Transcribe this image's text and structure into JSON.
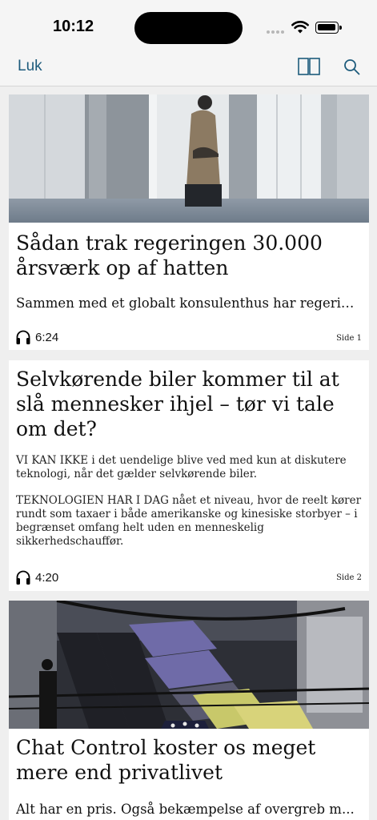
{
  "status_bar": {
    "time": "10:12",
    "icons": [
      "signal-icon",
      "wifi-icon",
      "battery-icon"
    ]
  },
  "nav": {
    "close_label": "Luk",
    "icons": [
      "pages-icon",
      "search-icon"
    ],
    "accent_color": "#1d5b7c"
  },
  "articles": [
    {
      "image": "office-window-photo",
      "headline": "Sådan trak regeringen 30.000 årsværk op af hatten",
      "teaser": "Sammen med et globalt konsulenthus har regeringen...",
      "audio_duration": "6:24",
      "page": "Side 1"
    },
    {
      "headline": "Selvkørende biler kommer til at slå mennesker ihjel – tør vi tale om det?",
      "body_p1": "VI KAN IKKE i det uendelige blive ved med kun at diskutere teknologi, når det gælder selvkørende biler.",
      "body_p2": "TEKNOLOGIEN HAR I DAG nået et niveau, hvor de reelt kører rundt som taxaer i både amerikanske og kinesiske storbyer – i begrænset omfang helt uden en menneskelig sikkerhedschauffør.",
      "audio_duration": "4:20",
      "page": "Side 2"
    },
    {
      "image": "staircase-photo",
      "headline": "Chat Control koster os meget mere end privatlivet",
      "teaser": "Alt har en pris. Også bekæmpelse af overgreb m..."
    }
  ]
}
